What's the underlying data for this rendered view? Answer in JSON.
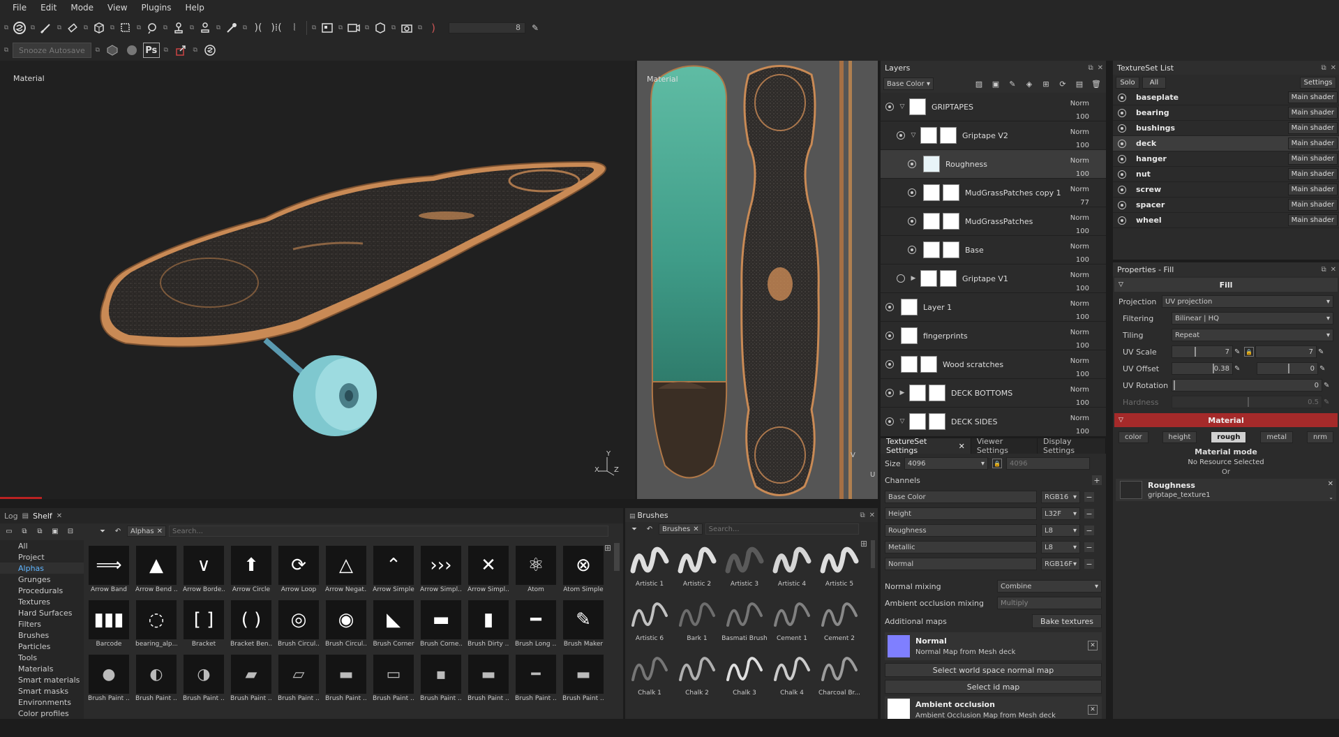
{
  "menu": [
    "File",
    "Edit",
    "Mode",
    "View",
    "Plugins",
    "Help"
  ],
  "toolbar": {
    "brush_size_value": "8",
    "snooze_autosave": "Snooze Autosave",
    "ps_label": "Ps"
  },
  "viewport3d": {
    "label": "Material",
    "axis_x": "X",
    "axis_y": "Y",
    "axis_z": "Z"
  },
  "viewport2d": {
    "label": "Material",
    "axis_u": "U",
    "axis_v": "V"
  },
  "layers": {
    "title": "Layers",
    "channel_select": "Base Color",
    "items": [
      {
        "name": "GRIPTAPES",
        "blend": "Norm",
        "opacity": "100",
        "indent": 0,
        "type": "group-open",
        "thumbs": 1,
        "visible": true
      },
      {
        "name": "Griptape V2",
        "blend": "Norm",
        "opacity": "100",
        "indent": 1,
        "type": "group-open",
        "thumbs": 2,
        "visible": true
      },
      {
        "name": "Roughness",
        "blend": "Norm",
        "opacity": "100",
        "indent": 2,
        "type": "fill",
        "thumbs": 1,
        "visible": true,
        "selected": true
      },
      {
        "name": "MudGrassPatches copy 1",
        "blend": "Norm",
        "opacity": "77",
        "indent": 2,
        "type": "fill",
        "thumbs": 2,
        "visible": true
      },
      {
        "name": "MudGrassPatches",
        "blend": "Norm",
        "opacity": "100",
        "indent": 2,
        "type": "fill",
        "thumbs": 2,
        "visible": true
      },
      {
        "name": "Base",
        "blend": "Norm",
        "opacity": "100",
        "indent": 2,
        "type": "fill",
        "thumbs": 2,
        "visible": true
      },
      {
        "name": "Griptape V1",
        "blend": "Norm",
        "opacity": "100",
        "indent": 1,
        "type": "group-closed",
        "thumbs": 2,
        "visible": false
      },
      {
        "name": "Layer 1",
        "blend": "Norm",
        "opacity": "100",
        "indent": 0,
        "type": "fill",
        "thumbs": 1,
        "visible": true
      },
      {
        "name": "fingerprints",
        "blend": "Norm",
        "opacity": "100",
        "indent": 0,
        "type": "fill",
        "thumbs": 1,
        "visible": true
      },
      {
        "name": "Wood scratches",
        "blend": "Norm",
        "opacity": "100",
        "indent": 0,
        "type": "fill",
        "thumbs": 2,
        "visible": true
      },
      {
        "name": "DECK BOTTOMS",
        "blend": "Norm",
        "opacity": "100",
        "indent": 0,
        "type": "group-closed",
        "thumbs": 2,
        "visible": true
      },
      {
        "name": "DECK SIDES",
        "blend": "Norm",
        "opacity": "100",
        "indent": 0,
        "type": "group-open",
        "thumbs": 2,
        "visible": true
      }
    ]
  },
  "ts_settings": {
    "tabs": [
      "TextureSet Settings",
      "Viewer Settings",
      "Display Settings"
    ],
    "size_label": "Size",
    "size_value": "4096",
    "size_value2": "4096",
    "channels_label": "Channels",
    "channels": [
      {
        "name": "Base Color",
        "format": "RGB16"
      },
      {
        "name": "Height",
        "format": "L32F"
      },
      {
        "name": "Roughness",
        "format": "L8"
      },
      {
        "name": "Metallic",
        "format": "L8"
      },
      {
        "name": "Normal",
        "format": "RGB16F"
      }
    ],
    "normal_mixing_label": "Normal mixing",
    "normal_mixing_value": "Combine",
    "ao_mixing_label": "Ambient occlusion mixing",
    "ao_mixing_value": "Multiply",
    "additional_maps_label": "Additional maps",
    "bake_button": "Bake textures",
    "normal_map_title": "Normal",
    "normal_map_sub": "Normal Map from Mesh deck",
    "select_ws_normal": "Select world space normal map",
    "select_id": "Select id map",
    "ao_title": "Ambient occlusion",
    "ao_sub": "Ambient Occlusion Map from Mesh deck"
  },
  "texlist": {
    "title": "TextureSet List",
    "solo": "Solo",
    "all": "All",
    "settings": "Settings",
    "items": [
      {
        "name": "baseplate",
        "shader": "Main shader"
      },
      {
        "name": "bearing",
        "shader": "Main shader"
      },
      {
        "name": "bushings",
        "shader": "Main shader"
      },
      {
        "name": "deck",
        "shader": "Main shader",
        "selected": true
      },
      {
        "name": "hanger",
        "shader": "Main shader"
      },
      {
        "name": "nut",
        "shader": "Main shader"
      },
      {
        "name": "screw",
        "shader": "Main shader"
      },
      {
        "name": "spacer",
        "shader": "Main shader"
      },
      {
        "name": "wheel",
        "shader": "Main shader"
      }
    ]
  },
  "props": {
    "title": "Properties - Fill",
    "fill_head": "Fill",
    "projection_label": "Projection",
    "projection_value": "UV projection",
    "filtering_label": "Filtering",
    "filtering_value": "Bilinear | HQ",
    "tiling_label": "Tiling",
    "tiling_value": "Repeat",
    "uvscale_label": "UV Scale",
    "uvscale_a": "7",
    "uvscale_b": "7",
    "uvoffset_label": "UV Offset",
    "uvoffset_a": "0.38",
    "uvoffset_b": "0",
    "uvrotation_label": "UV Rotation",
    "uvrotation_value": "0",
    "hardness_label": "Hardness",
    "hardness_value": "0.5",
    "material_head": "Material",
    "chips": [
      "color",
      "height",
      "rough",
      "metal",
      "nrm"
    ],
    "active_chip": "rough",
    "material_mode": "Material mode",
    "no_resource": "No Resource Selected",
    "or_label": "Or",
    "res_title": "Roughness",
    "res_sub": "griptape_texture1"
  },
  "shelf": {
    "tab_log": "Log",
    "tab_shelf": "Shelf",
    "filter_tag": "Alphas",
    "search_placeholder": "Search...",
    "categories": [
      "All",
      "Project",
      "Alphas",
      "Grunges",
      "Procedurals",
      "Textures",
      "Hard Surfaces",
      "Filters",
      "Brushes",
      "Particles",
      "Tools",
      "Materials",
      "Smart materials",
      "Smart masks",
      "Environments",
      "Color profiles"
    ],
    "active_category": "Alphas",
    "items": [
      "Arrow Band",
      "Arrow Bend ...",
      "Arrow Borde...",
      "Arrow Circle",
      "Arrow Loop",
      "Arrow Negat...",
      "Arrow Simple",
      "Arrow Simpl...",
      "Arrow Simpl...",
      "Atom",
      "Atom Simple",
      "Barcode",
      "bearing_alp...",
      "Bracket",
      "Bracket Ben...",
      "Brush Circul...",
      "Brush Circul...",
      "Brush Corner",
      "Brush Corne...",
      "Brush Dirty ...",
      "Brush Long ...",
      "Brush Maker",
      "Brush Paint ...",
      "Brush Paint ...",
      "Brush Paint ...",
      "Brush Paint ...",
      "Brush Paint ...",
      "Brush Paint ...",
      "Brush Paint ...",
      "Brush Paint ...",
      "Brush Paint ...",
      "Brush Paint ...",
      "Brush Paint ..."
    ]
  },
  "brushes": {
    "title": "Brushes",
    "filter_tag": "Brushes",
    "search_placeholder": "Search...",
    "items": [
      "Artistic 1",
      "Artistic 2",
      "Artistic 3",
      "Artistic 4",
      "Artistic 5",
      "Artistic 6",
      "Bark 1",
      "Basmati Brush",
      "Cement 1",
      "Cement 2",
      "Chalk 1",
      "Chalk 2",
      "Chalk 3",
      "Chalk 4",
      "Charcoal Br..."
    ]
  }
}
